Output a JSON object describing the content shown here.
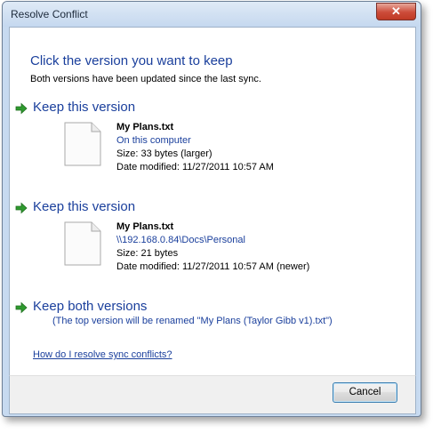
{
  "window": {
    "title": "Resolve Conflict",
    "close_label": "✕"
  },
  "dialog": {
    "heading": "Click the version you want to keep",
    "subheading": "Both versions have been updated since the last sync."
  },
  "options": [
    {
      "title": "Keep this version",
      "file_name": "My Plans.txt",
      "location": "On this computer",
      "size": "Size: 33 bytes (larger)",
      "modified": "Date modified: 11/27/2011 10:57 AM"
    },
    {
      "title": "Keep this version",
      "file_name": "My Plans.txt",
      "location": "\\\\192.168.0.84\\Docs\\Personal",
      "size": "Size: 21 bytes",
      "modified": "Date modified: 11/27/2011 10:57 AM (newer)"
    }
  ],
  "keep_both": {
    "title": "Keep both versions",
    "note": "(The top version will be renamed \"My Plans (Taylor Gibb v1).txt\")"
  },
  "help_link": "How do I resolve sync conflicts?",
  "footer": {
    "cancel_label": "Cancel"
  },
  "icons": {
    "option_arrow": "green-arrow-icon",
    "file": "text-file-icon"
  },
  "colors": {
    "accent_text": "#1a3f9c",
    "arrow": "#2f9a2f",
    "close_button": "#c9402c"
  }
}
